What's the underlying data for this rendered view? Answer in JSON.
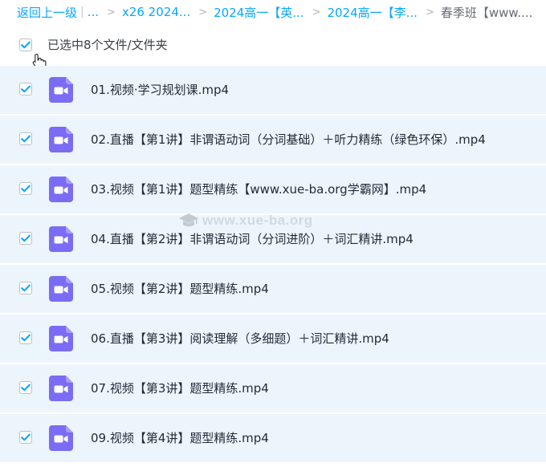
{
  "breadcrumb": {
    "back": "返回上一级",
    "separator": "|",
    "ellipsis": "...",
    "arrow": ">",
    "items": [
      "x26 2024...",
      "2024高一【英...",
      "2024高一【李...",
      "春季班【www...."
    ]
  },
  "selection": {
    "text": "已选中8个文件/文件夹",
    "all_checked": true
  },
  "files": [
    {
      "name": "01.视频·学习规划课.mp4",
      "checked": true
    },
    {
      "name": "02.直播【第1讲】非谓语动词（分词基础）＋听力精练（绿色环保）.mp4",
      "checked": true
    },
    {
      "name": "03.视频【第1讲】题型精练【www.xue-ba.org学霸网】.mp4",
      "checked": true
    },
    {
      "name": "04.直播【第2讲】非谓语动词（分词进阶）＋词汇精讲.mp4",
      "checked": true
    },
    {
      "name": "05.视频【第2讲】题型精练.mp4",
      "checked": true
    },
    {
      "name": "06.直播【第3讲】阅读理解（多细题）＋词汇精讲.mp4",
      "checked": true
    },
    {
      "name": "07.视频【第3讲】题型精练.mp4",
      "checked": true
    },
    {
      "name": "09.视频【第4讲】题型精练.mp4",
      "checked": true
    }
  ],
  "watermark": {
    "text": "www.xue-ba.org",
    "icon": "graduation-cap-icon"
  },
  "colors": {
    "accent": "#06a7ff",
    "row_background": "#edf5fc",
    "video_icon": "#7a6cf5"
  },
  "icons": {
    "file": "video-file-icon",
    "checkbox": "checkmark-icon",
    "cursor": "hand-pointer-icon"
  }
}
